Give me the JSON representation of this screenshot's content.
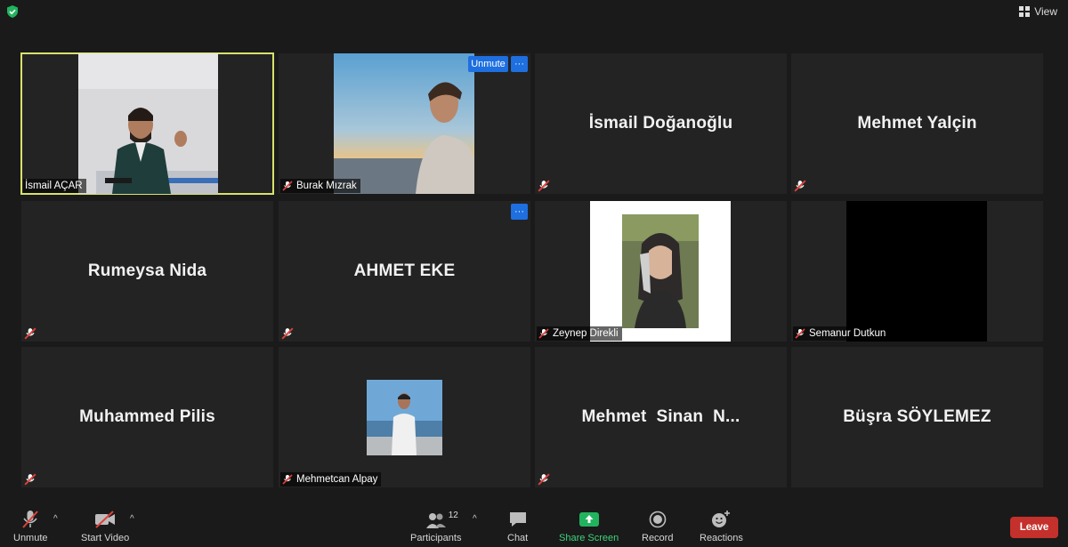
{
  "header": {
    "view_label": "View"
  },
  "tiles": [
    {
      "name": "İsmail AÇAR"
    },
    {
      "name": "Burak Mızrak",
      "unmute_label": "Unmute",
      "more_label": "···"
    },
    {
      "name": "İsmail Doğanoğlu"
    },
    {
      "name": "Mehmet Yalçin"
    },
    {
      "name": "Rumeysa Nida"
    },
    {
      "name": "AHMET EKE",
      "more_label": "···"
    },
    {
      "name": "Zeynep Direkli"
    },
    {
      "name": "Semanur Dutkun"
    },
    {
      "name": "Muhammed Pilis"
    },
    {
      "name": "Mehmetcan Alpay"
    },
    {
      "name": "Mehmet  Sinan  N..."
    },
    {
      "name": "Büşra SÖYLEMEZ"
    }
  ],
  "toolbar": {
    "unmute": "Unmute",
    "start_video": "Start Video",
    "participants": "Participants",
    "participants_count": "12",
    "chat": "Chat",
    "share_screen": "Share Screen",
    "record": "Record",
    "reactions": "Reactions",
    "leave": "Leave",
    "caret": "^"
  },
  "colors": {
    "active_border": "#d8e26b",
    "share_green": "#3fd37a",
    "leave_red": "#c4302b",
    "accent_blue": "#1e6fe0"
  }
}
